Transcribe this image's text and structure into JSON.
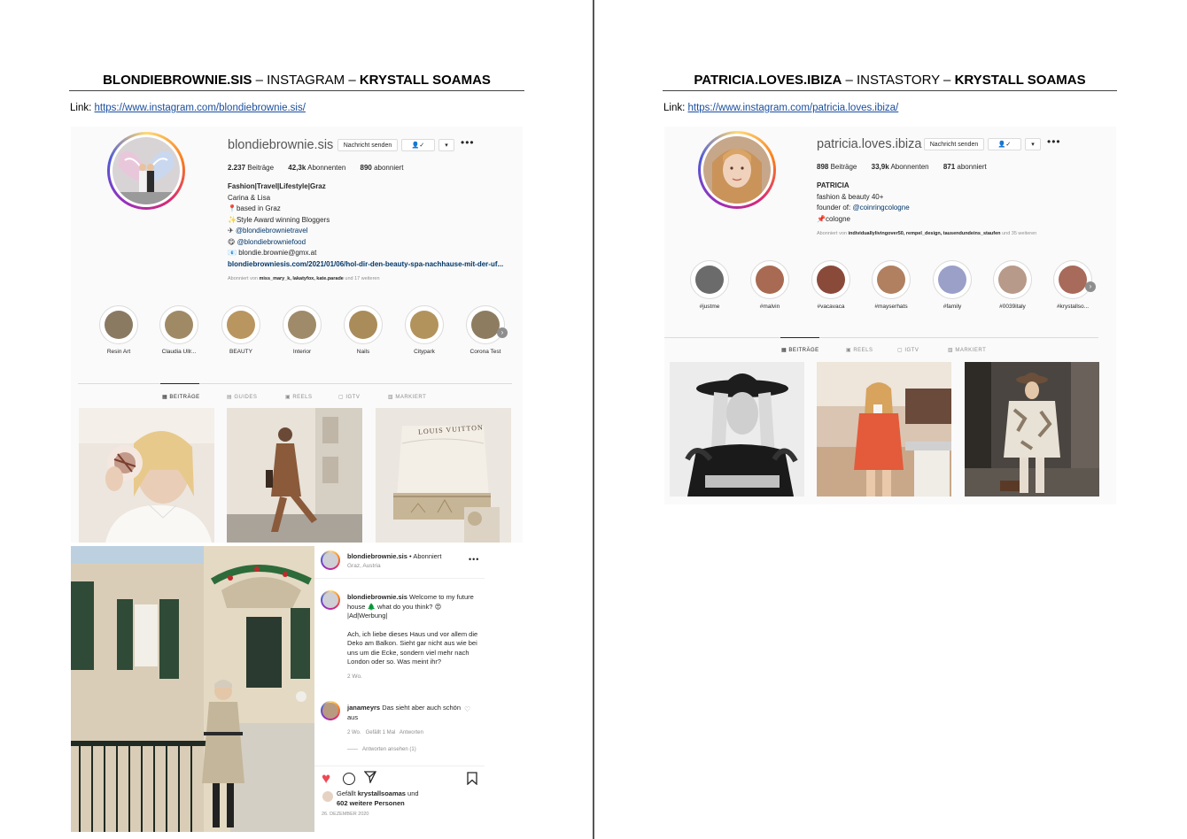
{
  "left": {
    "title_bold1": "BLONDIEBROWNIE.SIS",
    "title_mid": " – INSTAGRAM – ",
    "title_bold2": "KRYSTALL SOAMAS",
    "link_label": "Link: ",
    "link_url": "https://www.instagram.com/blondiebrownie.sis/",
    "profile": {
      "username": "blondiebrownie.sis",
      "message_button": "Nachricht senden",
      "posts": "2.237",
      "posts_label": " Beiträge",
      "followers": "42,3k",
      "followers_label": " Abonnenten",
      "following": "890",
      "following_label": " abonniert",
      "bio_title": "Fashion|Travel|Lifestyle|Graz",
      "bio_names": "Carina & Lisa",
      "bio_location": "📍based in Graz",
      "bio_award": "✨Style Award winning Bloggers",
      "bio_travel": "@blondiebrownietravel",
      "bio_food": "@blondiebrowniefood",
      "bio_email": "blondie.brownie@gmx.at",
      "bio_url": "blondiebrowniesis.com/2021/01/06/hol-dir-den-beauty-spa-nachhause-mit-der-uf...",
      "followed_by_prefix": "Abonniert von ",
      "followed_by_names": "miss_mary_k, lakatyfox, kate.parade",
      "followed_by_suffix": " und 17 weiteren"
    },
    "highlights": [
      "Resin Art",
      "Claudia Ullr...",
      "BEAUTY",
      "Interior",
      "Nails",
      "Citypark",
      "Corona Test"
    ],
    "tabs": [
      "BEITRÄGE",
      "GUIDES",
      "REELS",
      "IGTV",
      "MARKIERT"
    ],
    "post": {
      "author": "blondiebrownie.sis",
      "follow_state": " • Abonniert",
      "location": "Graz, Austria",
      "caption_author": "blondiebrownie.sis",
      "caption_1": " Welcome to my future house 🌲 what do you think? 😍",
      "caption_2": "|Ad|Werbung|",
      "caption_3": "Ach, ich liebe dieses Haus und vor allem die Deko am Balkon. Sieht gar nicht aus wie bei uns um die Ecke, sondern viel mehr nach London oder so. Was meint ihr?",
      "caption_time": "2 Wo.",
      "comment_author": "janameyrs",
      "comment_text": " Das sieht aber auch schön aus ",
      "comment_meta": "2 Wo.   Gefällt 1 Mal   Antworten",
      "view_replies": "Antworten ansehen (1)",
      "likes_prefix": "Gefällt ",
      "likes_name": "krystallsoamas",
      "likes_mid": " und",
      "likes_count": "602 weitere Personen",
      "date": "26. DEZEMBER 2020",
      "louis_vuitton": "LOUIS VUITTON"
    }
  },
  "right": {
    "title_bold1": "PATRICIA.LOVES.IBIZA",
    "title_mid": " – INSTASTORY – ",
    "title_bold2": "KRYSTALL SOAMAS",
    "link_label": "Link: ",
    "link_url": "https://www.instagram.com/patricia.loves.ibiza/",
    "profile": {
      "username": "patricia.loves.ibiza",
      "message_button": "Nachricht senden",
      "posts": "898",
      "posts_label": " Beiträge",
      "followers": "33,9k",
      "followers_label": " Abonnenten",
      "following": "871",
      "following_label": " abonniert",
      "bio_name": "PATRICIA",
      "bio_1": "fashion & beauty 40+",
      "bio_2_prefix": "founder of: ",
      "bio_2_link": "@coinringcologne",
      "bio_3": "📌cologne",
      "followed_by_prefix": "Abonniert von ",
      "followed_by_names": "individuallylivingover50, rempel_design, tausendundeins_staufen",
      "followed_by_suffix": " und 35 weiteren"
    },
    "highlights": [
      "#justme",
      "#malvin",
      "#vacavaca",
      "#mayserhats",
      "#family",
      "#0039italy",
      "#krystallso..."
    ],
    "tabs": [
      "BEITRÄGE",
      "REELS",
      "IGTV",
      "MARKIERT"
    ]
  },
  "colors": {
    "link": "#1a4fa0",
    "ig_link": "#00376b",
    "heart": "#ed4956",
    "border": "#dbdbdb",
    "muted": "#8e8e8e"
  },
  "icons": [
    "user-check-icon",
    "chevron-down-icon",
    "more-icon",
    "grid-icon",
    "guides-icon",
    "reels-icon",
    "igtv-icon",
    "tagged-icon",
    "heart-icon",
    "comment-icon",
    "share-icon",
    "bookmark-icon",
    "plane-icon",
    "food-icon",
    "mail-icon",
    "chevron-right-icon"
  ]
}
